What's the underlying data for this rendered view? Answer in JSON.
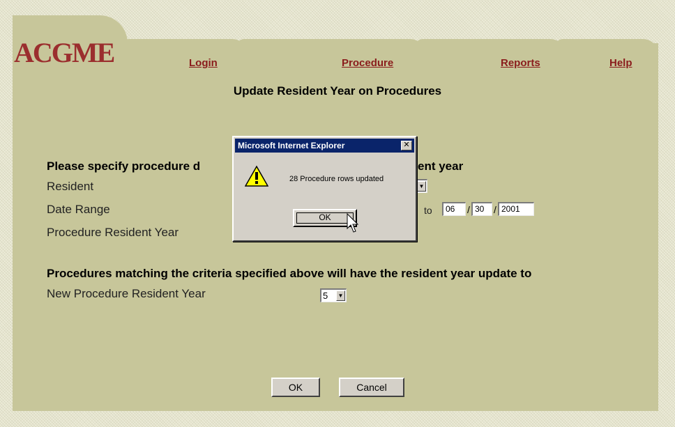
{
  "logo": {
    "text": "ACGME"
  },
  "nav": {
    "tabs": [
      {
        "label": "Login"
      },
      {
        "label": "Procedure"
      },
      {
        "label": "Reports"
      },
      {
        "label": "Help"
      }
    ]
  },
  "page": {
    "title": "Update Resident Year on Procedures",
    "section1_heading_left": "Please specify procedure d",
    "section1_heading_right": "ent year",
    "fields": {
      "resident_label": "Resident",
      "date_range_label": "Date Range",
      "procedure_year_label": "Procedure Resident Year",
      "date_to_label": "to",
      "date_to_month": "06",
      "date_to_day": "30",
      "date_to_year": "2001"
    },
    "section2_heading": "Procedures matching the criteria specified above will have the resident year update to",
    "new_year_label": "New Procedure Resident Year",
    "new_year_value": "5",
    "ok_label": "OK",
    "cancel_label": "Cancel"
  },
  "dialog": {
    "title": "Microsoft Internet Explorer",
    "close_glyph": "✕",
    "message": "28 Procedure rows updated",
    "ok_label": "OK",
    "icon": "warning-icon"
  },
  "colors": {
    "panel": "#c7c69a",
    "link": "#8a1c1c",
    "logo": "#9b2e2e",
    "titlebar": "#0a246a"
  }
}
